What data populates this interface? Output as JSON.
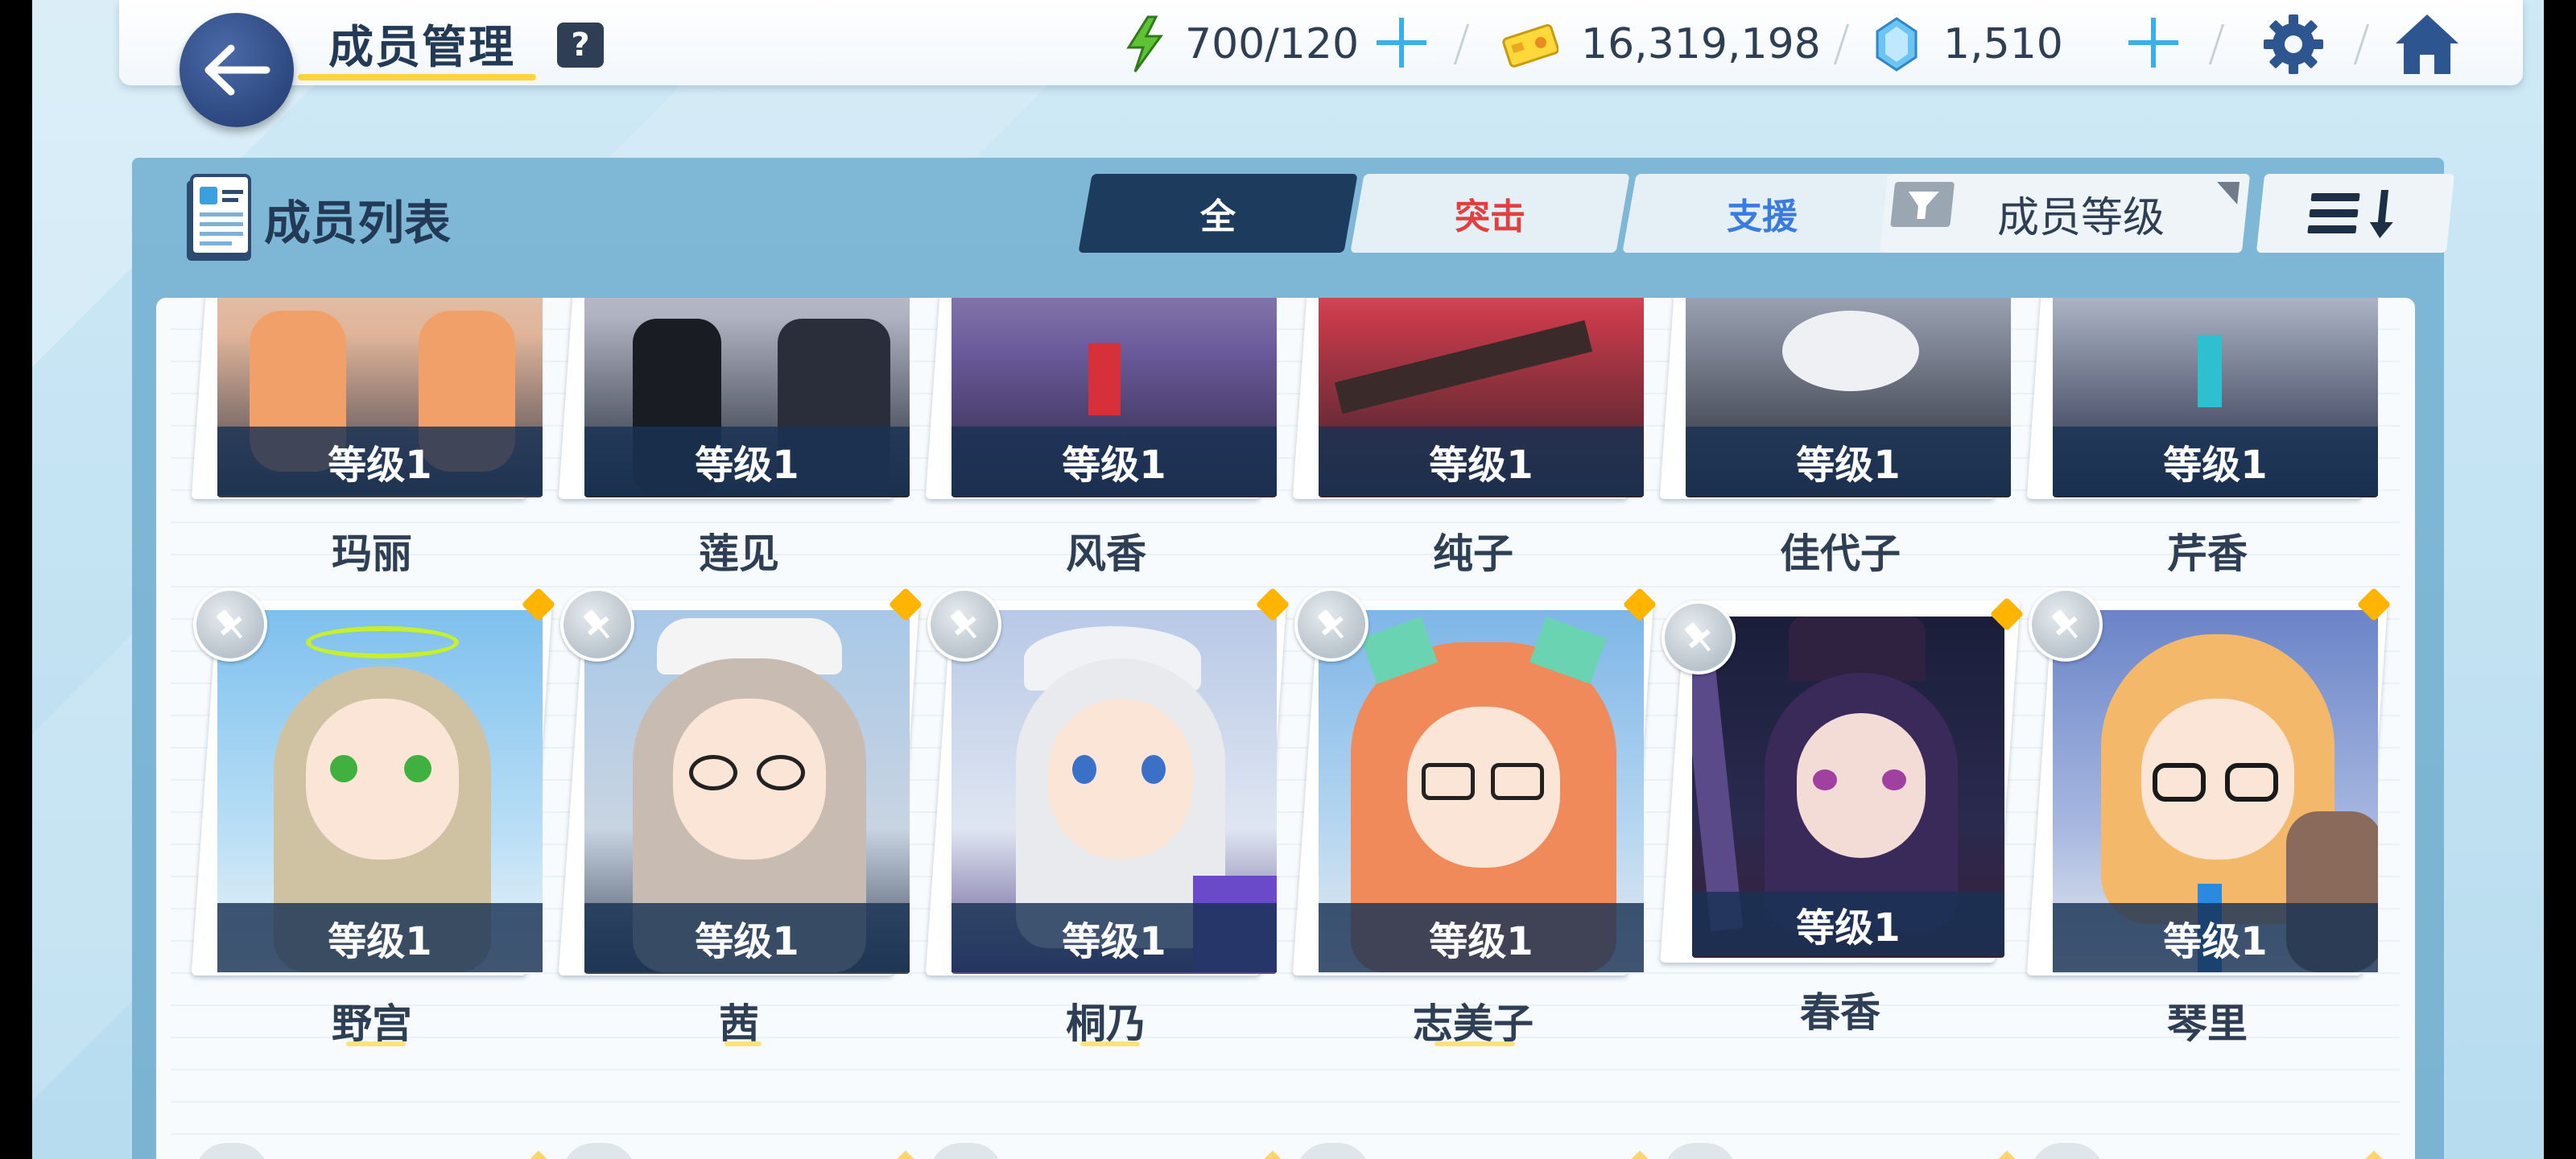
{
  "header": {
    "title": "成员管理",
    "help": "?",
    "ap": "700/120",
    "credits": "16,319,198",
    "gems": "1,510"
  },
  "panel": {
    "title": "成员列表",
    "tabs": [
      {
        "label": "全",
        "state": "active"
      },
      {
        "label": "突击",
        "color": "#e0403f"
      },
      {
        "label": "支援",
        "color": "#3a7be0"
      }
    ],
    "sort_label": "成员等级"
  },
  "colors": {
    "accent_dark": "#1d3b5c",
    "striker": "#e0403f",
    "special": "#3a7be0",
    "highlight": "#ffd33d",
    "badge_orange": "#ffb400"
  },
  "row1": [
    {
      "name": "玛丽",
      "level": "等级1"
    },
    {
      "name": "莲见",
      "level": "等级1"
    },
    {
      "name": "风香",
      "level": "等级1"
    },
    {
      "name": "纯子",
      "level": "等级1"
    },
    {
      "name": "佳代子",
      "level": "等级1"
    },
    {
      "name": "芹香",
      "level": "等级1"
    }
  ],
  "row2": [
    {
      "name": "野宫",
      "level": "等级1"
    },
    {
      "name": "茜",
      "level": "等级1"
    },
    {
      "name": "桐乃",
      "level": "等级1"
    },
    {
      "name": "志美子",
      "level": "等级1"
    },
    {
      "name": "春香",
      "level": "等级1"
    },
    {
      "name": "琴里",
      "level": "等级1"
    }
  ]
}
